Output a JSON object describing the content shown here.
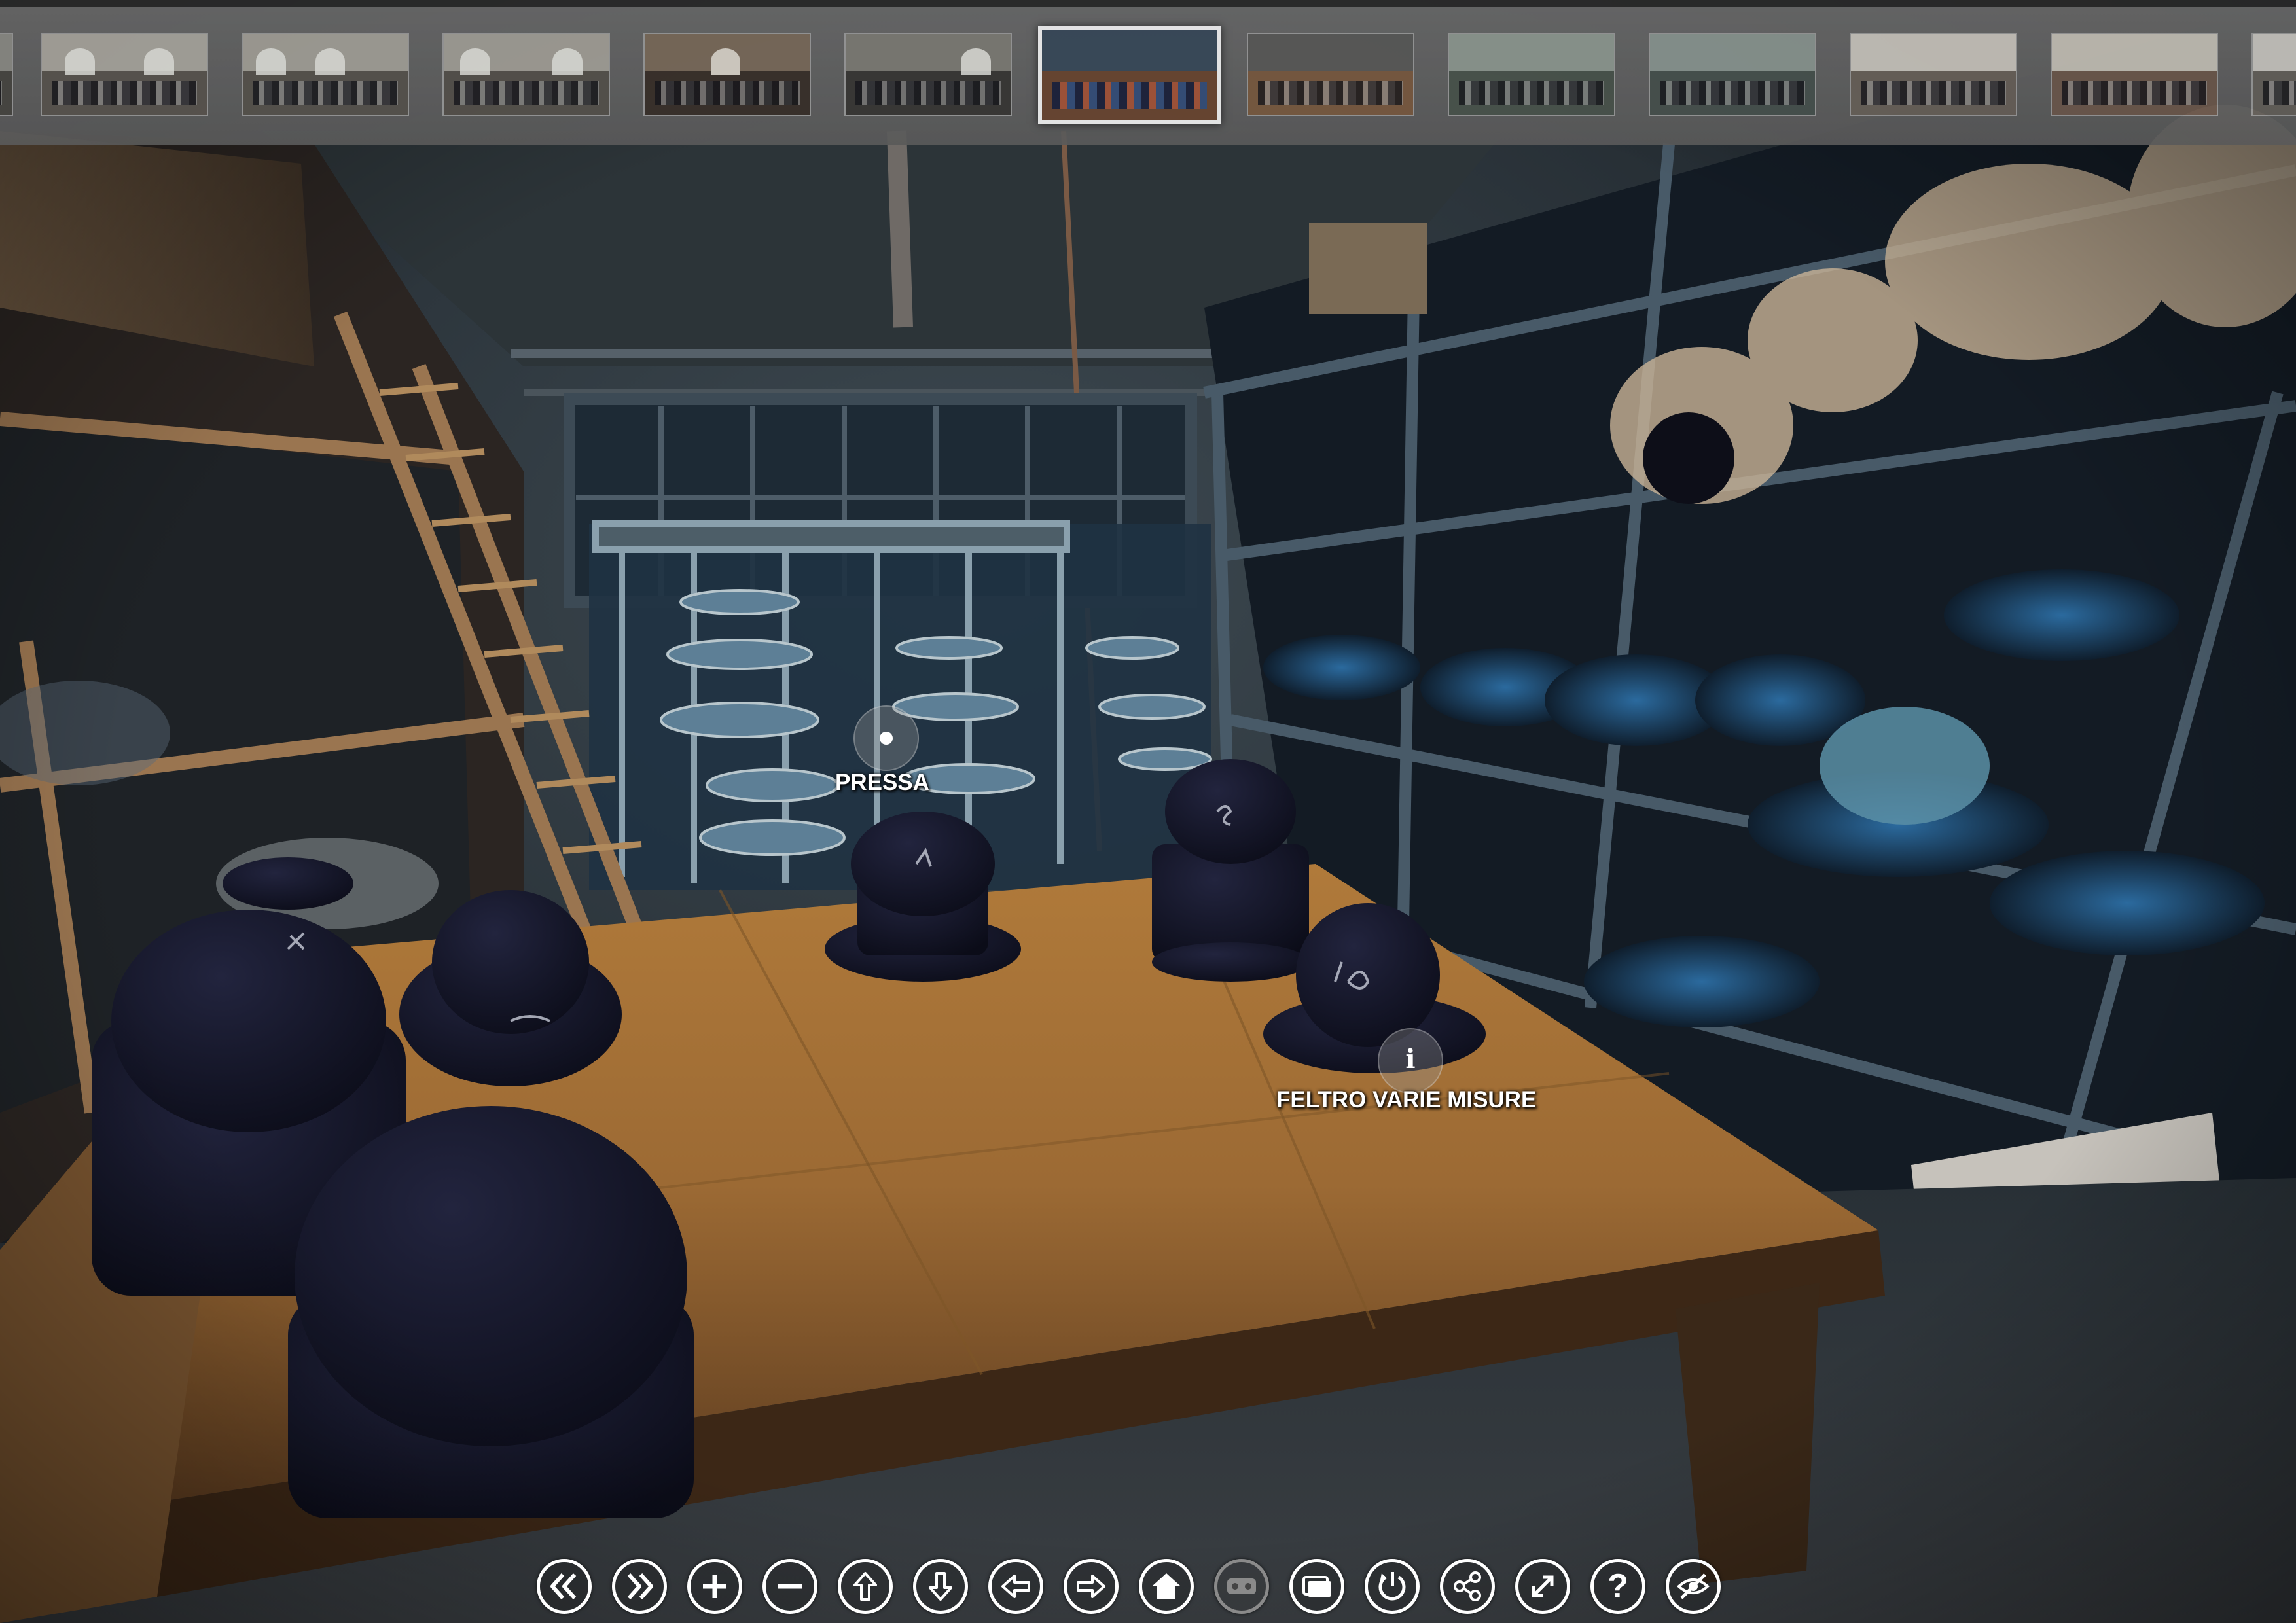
{
  "viewer": {
    "thumbnails": [
      {
        "label": "",
        "active": false
      },
      {
        "label": "",
        "active": false
      },
      {
        "label": "",
        "active": false
      },
      {
        "label": "",
        "active": false
      },
      {
        "label": "",
        "active": false
      },
      {
        "label": "",
        "active": false
      },
      {
        "label": "",
        "active": true
      },
      {
        "label": "",
        "active": false
      },
      {
        "label": "",
        "active": false
      },
      {
        "label": "",
        "active": false
      },
      {
        "label": "",
        "active": false
      },
      {
        "label": "",
        "active": false
      },
      {
        "label": "",
        "active": false
      }
    ],
    "hotspots": {
      "pressa": {
        "label": "PRESSA",
        "icon": "navigation-dot-icon"
      },
      "feltro": {
        "label": "FELTRO VARIE MISURE",
        "icon": "info-icon",
        "symbol": "i"
      }
    },
    "controls": {
      "first": {
        "icon": "double-chevron-left-icon"
      },
      "last": {
        "icon": "double-chevron-right-icon"
      },
      "zoom_in": {
        "icon": "plus-icon"
      },
      "zoom_out": {
        "icon": "minus-icon"
      },
      "up": {
        "icon": "arrow-up-icon"
      },
      "down": {
        "icon": "arrow-down-icon"
      },
      "left": {
        "icon": "arrow-left-icon"
      },
      "right": {
        "icon": "arrow-right-icon"
      },
      "home": {
        "icon": "home-icon"
      },
      "vr": {
        "icon": "vr-headset-icon",
        "enabled": false
      },
      "gallery": {
        "icon": "gallery-icon"
      },
      "autorotate": {
        "icon": "autorotate-icon"
      },
      "share": {
        "icon": "share-icon"
      },
      "fullscreen": {
        "icon": "fullscreen-icon"
      },
      "help": {
        "icon": "help-icon",
        "symbol": "?"
      },
      "hide": {
        "icon": "hide-eye-icon"
      }
    },
    "colors": {
      "table": "#a8773d",
      "shadow_blue": "#1b3550",
      "hat": "#14152a",
      "control_ring": "#ffffff"
    }
  }
}
